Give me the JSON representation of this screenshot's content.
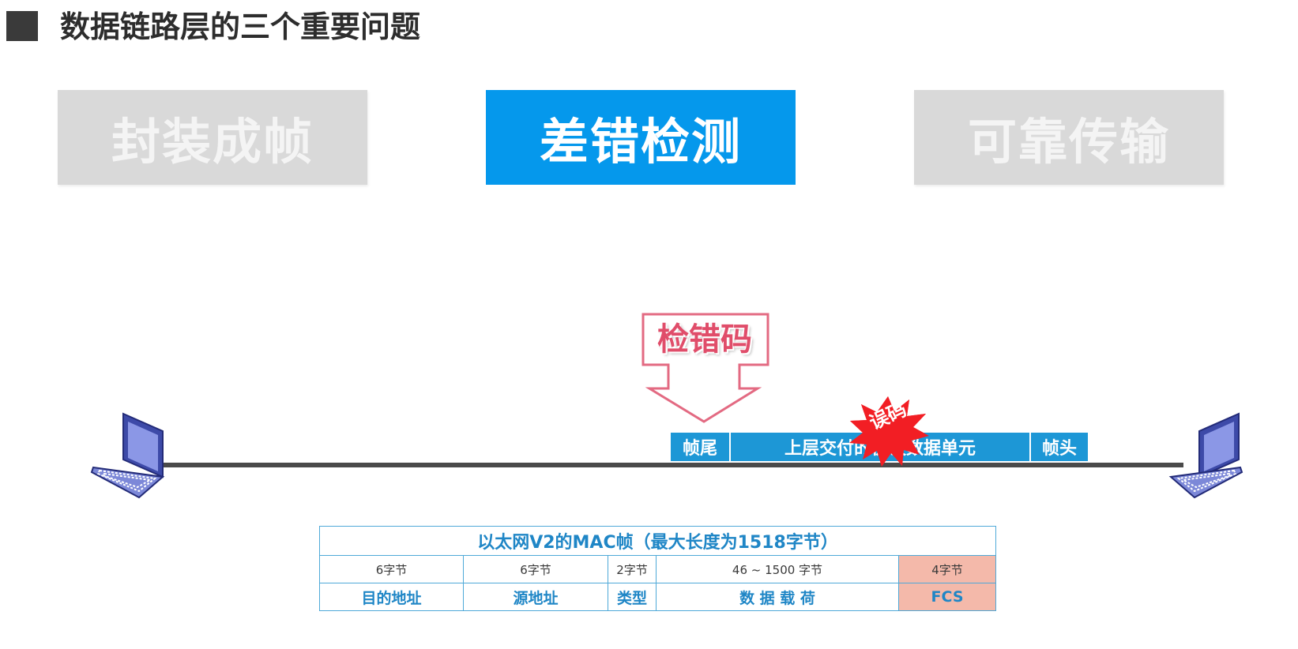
{
  "page": {
    "title": "数据链路层的三个重要问题"
  },
  "topics": [
    {
      "label": "封装成帧",
      "active": false
    },
    {
      "label": "差错检测",
      "active": true
    },
    {
      "label": "可靠传输",
      "active": false
    }
  ],
  "callout": {
    "label": "检错码"
  },
  "error_burst": {
    "label": "误码"
  },
  "frame": {
    "tail": "帧尾",
    "payload": "上层交付的协议数据单元",
    "head": "帧头"
  },
  "mac_frame": {
    "caption": "以太网V2的MAC帧（最大长度为1518字节）",
    "sizes": [
      "6字节",
      "6字节",
      "2字节",
      "46 ~ 1500 字节",
      "4字节"
    ],
    "fields": [
      "目的地址",
      "源地址",
      "类型",
      "数 据 载 荷",
      "FCS"
    ]
  },
  "colors": {
    "accent": "#0598ec",
    "frame": "#1d97d6",
    "callout": "#e04d6a",
    "burst": "#f21e24",
    "fcs": "#f4b9aa"
  }
}
